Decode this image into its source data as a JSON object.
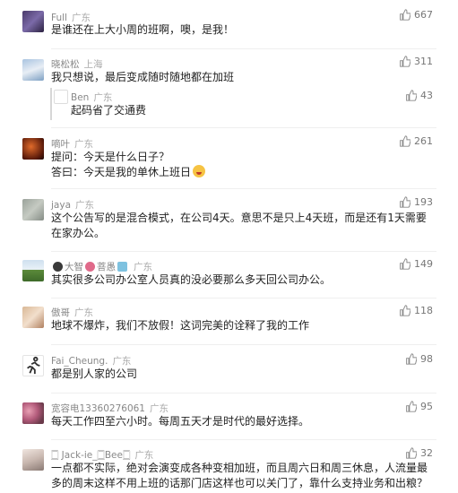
{
  "comments": [
    {
      "name": "Full",
      "location": "广东",
      "likes": "667",
      "text": "是谁还在上大小周的班啊，噢，是我！"
    },
    {
      "name": "晓松松",
      "location": "上海",
      "likes": "311",
      "text": "我只想说，最后变成随时随地都在加班",
      "reply": {
        "name": "Ben",
        "location": "广东",
        "likes": "43",
        "text": "起码省了交通费"
      }
    },
    {
      "name": "嘀叶",
      "location": "广东",
      "likes": "261",
      "text1": "提问：今天是什么日子？",
      "text2": "答曰：今天是我的单休上班日"
    },
    {
      "name": "jaya",
      "location": "广东",
      "likes": "193",
      "text": "这个公告写的是混合模式，在公司4天。意思不是只上4天班，而是还有1天需要在家办公。"
    },
    {
      "name_a": "大智",
      "name_b": "菩愚",
      "location": "广东",
      "likes": "149",
      "text": "其实很多公司办公室人员真的没必要那么多天回公司办公。"
    },
    {
      "name": "傲哥",
      "location": "广东",
      "likes": "118",
      "text": "地球不爆炸，我们不放假！这词完美的诠释了我的工作"
    },
    {
      "name": "Fai_Cheung.",
      "location": "广东",
      "likes": "98",
      "text": "都是别人家的公司"
    },
    {
      "name": "宽容电13360276061",
      "location": "广东",
      "likes": "95",
      "text": "每天工作四至六小时。每周五天才是时代的最好选择。"
    },
    {
      "name": "🀆 Jack-ie_🀆Bee🀆",
      "location": "广东",
      "likes": "32",
      "text": "一点都不实际，绝对会演变成各种变相加班，而且周六日和周三休息，人流量最多的周末这样不用上班的话那门店这样也可以关门了，靠什么支持业务和出粮？"
    }
  ],
  "icons": {
    "like": "thumbs-up-icon"
  },
  "colors": {
    "text": "#222222",
    "meta": "#888888",
    "divider": "#efefef"
  }
}
